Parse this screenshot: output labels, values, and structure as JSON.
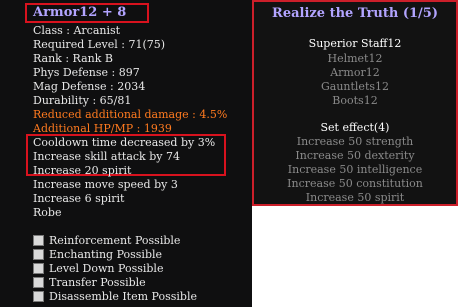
{
  "item": {
    "title": "Armor12 + 8",
    "class": "Class : Arcanist",
    "required_level": "Required Level : 71(75)",
    "rank": "Rank : Rank B",
    "phys_def": "Phys Defense : 897",
    "mag_def": "Mag Defense : 2034",
    "durability": "Durability : 65/81",
    "reduced_damage": "Reduced additional damage : 4.5%",
    "additional_hpmp": "Additional HP/MP : 1939",
    "stats": [
      "Cooldown time decreased by 3%",
      "Increase skill attack by 74",
      "Increase 20 spirit",
      "Increase move speed by 3",
      "Increase 6 spirit",
      "Robe"
    ],
    "possibilities": [
      {
        "icon": "reinforcement-icon",
        "label": "Reinforcement Possible"
      },
      {
        "icon": "enchanting-icon",
        "label": "Enchanting Possible"
      },
      {
        "icon": "level-down-icon",
        "label": "Level Down Possible"
      },
      {
        "icon": "transfer-icon",
        "label": "Transfer Possible"
      },
      {
        "icon": "disassemble-icon",
        "label": "Disassemble Item Possible"
      }
    ]
  },
  "set": {
    "title": "Realize the Truth (1/5)",
    "items": [
      "Superior Staff12",
      "Helmet12",
      "Armor12",
      "Gauntlets12",
      "Boots12"
    ],
    "effect_header": "Set effect(4)",
    "effects": [
      "Increase 50 strength",
      "Increase 50 dexterity",
      "Increase 50 intelligence",
      "Increase 50 constitution",
      "Increase 50 spirit"
    ]
  }
}
